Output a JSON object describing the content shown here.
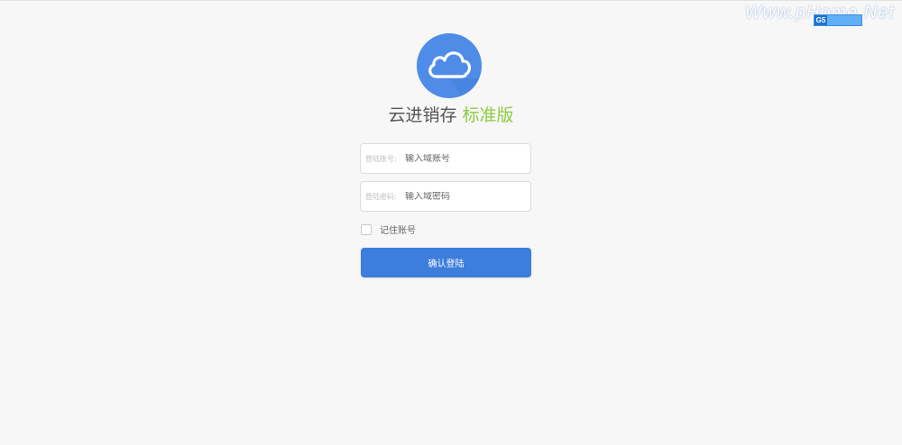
{
  "watermark": "Www.pHome.Net",
  "badge": {
    "logo_text": "G5"
  },
  "header": {
    "app_name": "云进销存",
    "edition": "标准版"
  },
  "login": {
    "account_label": "登陆账号:",
    "account_placeholder": "输入域账号",
    "password_label": "登陆密码:",
    "password_placeholder": "输入域密码",
    "remember_label": "记住账号",
    "remember_checked": false,
    "submit_label": "确认登陆"
  },
  "colors": {
    "accent": "#3d7ddc",
    "logo_bg": "#4f8ce8",
    "edition_text": "#8ccb3e"
  },
  "icons": {
    "logo": "cloud-icon"
  }
}
